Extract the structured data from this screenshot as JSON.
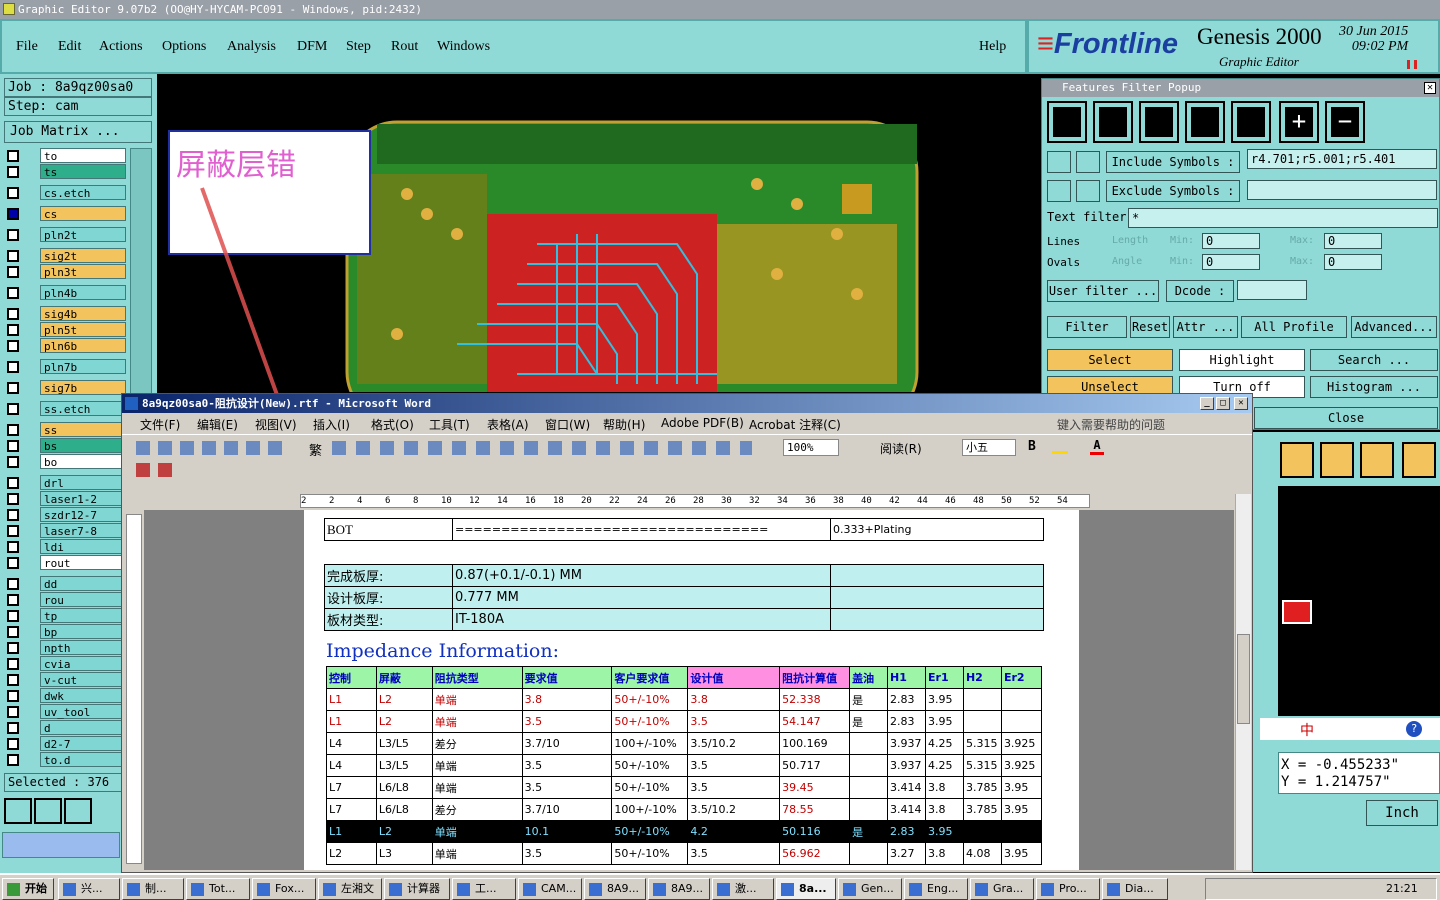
{
  "app": {
    "title": "Graphic Editor 9.07b2  (OO@HY-HYCAM-PC091 - Windows, pid:2432)",
    "menu": [
      "File",
      "Edit",
      "Actions",
      "Options",
      "Analysis",
      "DFM",
      "Step",
      "Rout",
      "Windows"
    ],
    "help": "Help",
    "brand": "Frontline",
    "product": "Genesis 2000",
    "subtitle": "Graphic Editor",
    "date": "30 Jun 2015",
    "time": "09:02 PM"
  },
  "left": {
    "job": "Job : 8a9qz00sa0",
    "step": "Step: cam",
    "job_matrix": "Job Matrix ...",
    "selected": "Selected : 376",
    "layers": [
      {
        "name": "to",
        "color": "#ffffff"
      },
      {
        "name": "ts",
        "color": "#2fae8c"
      },
      {
        "name": "cs.etch",
        "color": "#7fd6d2"
      },
      {
        "name": "cs",
        "color": "#f3c35e",
        "active": true
      },
      {
        "name": "pln2t",
        "color": "#7fd6d2"
      },
      {
        "name": "sig2t",
        "color": "#f3c35e"
      },
      {
        "name": "pln3t",
        "color": "#f3c35e"
      },
      {
        "name": "pln4b",
        "color": "#7fd6d2"
      },
      {
        "name": "sig4b",
        "color": "#f3c35e"
      },
      {
        "name": "pln5t",
        "color": "#f3c35e"
      },
      {
        "name": "pln6b",
        "color": "#f3c35e"
      },
      {
        "name": "pln7b",
        "color": "#7fd6d2"
      },
      {
        "name": "sig7b",
        "color": "#f3c35e"
      },
      {
        "name": "ss.etch",
        "color": "#7fd6d2"
      },
      {
        "name": "ss",
        "color": "#f3c35e"
      },
      {
        "name": "bs",
        "color": "#2fae8c"
      },
      {
        "name": "bo",
        "color": "#ffffff"
      },
      {
        "name": "drl",
        "color": "#7fd6d2"
      },
      {
        "name": "laser1-2",
        "color": "#7fd6d2"
      },
      {
        "name": "szdr12-7",
        "color": "#7fd6d2"
      },
      {
        "name": "laser7-8",
        "color": "#7fd6d2"
      },
      {
        "name": "ldi",
        "color": "#7fd6d2"
      },
      {
        "name": "rout",
        "color": "#ffffff"
      },
      {
        "name": "dd",
        "color": "#7fd6d2"
      },
      {
        "name": "rou",
        "color": "#7fd6d2"
      },
      {
        "name": "tp",
        "color": "#7fd6d2"
      },
      {
        "name": "bp",
        "color": "#7fd6d2"
      },
      {
        "name": "npth",
        "color": "#7fd6d2"
      },
      {
        "name": "cvia",
        "color": "#7fd6d2"
      },
      {
        "name": "v-cut",
        "color": "#7fd6d2"
      },
      {
        "name": "dwk",
        "color": "#7fd6d2"
      },
      {
        "name": "uv_tool",
        "color": "#7fd6d2"
      },
      {
        "name": "d",
        "color": "#7fd6d2"
      },
      {
        "name": "d2-7",
        "color": "#7fd6d2"
      },
      {
        "name": "to.d",
        "color": "#7fd6d2"
      }
    ]
  },
  "annotation": "屏蔽层错",
  "filter": {
    "title": "Features Filter Popup",
    "include_label": "Include Symbols :",
    "include_value": "r4.701;r5.001;r5.401",
    "exclude_label": "Exclude Symbols :",
    "exclude_value": "",
    "text_filter_label": "Text filter",
    "text_filter_value": "*",
    "lines": "Lines",
    "ovals": "Ovals",
    "length": "Length",
    "angle": "Angle",
    "min": "Min:",
    "max": "Max:",
    "zero": "0",
    "user_filter": "User filter ...",
    "dcode": "Dcode :",
    "filter": "Filter",
    "reset": "Reset",
    "attr": "Attr ...",
    "all_profile": "All Profile",
    "advanced": "Advanced...",
    "select": "Select",
    "highlight": "Highlight",
    "search": "Search ...",
    "unselect": "Unselect",
    "turn_off": "Turn off",
    "histogram": "Histogram ...",
    "close": "Close"
  },
  "coords": {
    "x": "X = -0.455233\"",
    "y": "Y = 1.214757\"",
    "unit": "Inch"
  },
  "ime": "中",
  "word": {
    "title": "8a9qz00sa0-阻抗设计(New).rtf - Microsoft Word",
    "menu": [
      "文件(F)",
      "编辑(E)",
      "视图(V)",
      "插入(I)",
      "格式(O)",
      "工具(T)",
      "表格(A)",
      "窗口(W)",
      "帮助(H)",
      "Adobe PDF(B)",
      "Acrobat 注释(C)"
    ],
    "help_prompt": "键入需要帮助的问题",
    "zoom": "100%",
    "read": "阅读(R)",
    "font_size": "小五",
    "bold": "B",
    "fan": "繁",
    "ruler": [
      "2",
      "2",
      "4",
      "6",
      "8",
      "10",
      "12",
      "14",
      "16",
      "18",
      "20",
      "22",
      "24",
      "26",
      "28",
      "30",
      "32",
      "34",
      "36",
      "38",
      "40",
      "42",
      "44",
      "46",
      "48",
      "50",
      "52",
      "54"
    ],
    "bot_row": {
      "name": "BOT",
      "fill": "==================================",
      "val": "0.333+Plating"
    },
    "specs": [
      {
        "k": "完成板厚:",
        "v": "0.87(+0.1/-0.1) MM"
      },
      {
        "k": "设计板厚:",
        "v": "0.777 MM"
      },
      {
        "k": "板材类型:",
        "v": "IT-180A"
      }
    ],
    "impedance_title": "Impedance Information:",
    "headers": [
      "控制",
      "屏蔽",
      "阻抗类型",
      "要求值",
      "客户要求值",
      "设计值",
      "阻抗计算值",
      "盖油",
      "H1",
      "Er1",
      "H2",
      "Er2"
    ],
    "rows": [
      {
        "style": "red",
        "c": [
          "L1",
          "L2",
          "单端",
          "3.8",
          "50+/-10%",
          "3.8",
          "52.338",
          "是",
          "2.83",
          "3.95",
          "",
          ""
        ]
      },
      {
        "style": "red",
        "c": [
          "L1",
          "L2",
          "单端",
          "3.5",
          "50+/-10%",
          "3.5",
          "54.147",
          "是",
          "2.83",
          "3.95",
          "",
          ""
        ]
      },
      {
        "style": "normal",
        "c": [
          "L4",
          "L3/L5",
          "差分",
          "3.7/10",
          "100+/-10%",
          "3.5/10.2",
          "100.169",
          "",
          "3.937",
          "4.25",
          "5.315",
          "3.925"
        ]
      },
      {
        "style": "normal",
        "c": [
          "L4",
          "L3/L5",
          "单端",
          "3.5",
          "50+/-10%",
          "3.5",
          "50.717",
          "",
          "3.937",
          "4.25",
          "5.315",
          "3.925"
        ]
      },
      {
        "style": "mixed",
        "c": [
          "L7",
          "L6/L8",
          "单端",
          "3.5",
          "50+/-10%",
          "3.5",
          "39.45",
          "",
          "3.414",
          "3.8",
          "3.785",
          "3.95"
        ]
      },
      {
        "style": "mixed",
        "c": [
          "L7",
          "L6/L8",
          "差分",
          "3.7/10",
          "100+/-10%",
          "3.5/10.2",
          "78.55",
          "",
          "3.414",
          "3.8",
          "3.785",
          "3.95"
        ]
      },
      {
        "style": "black",
        "c": [
          "L1",
          "L2",
          "单端",
          "10.1",
          "50+/-10%",
          "4.2",
          "50.116",
          "是",
          "2.83",
          "3.95",
          "",
          ""
        ]
      },
      {
        "style": "mixed",
        "c": [
          "L2",
          "L3",
          "单端",
          "3.5",
          "50+/-10%",
          "3.5",
          "56.962",
          "",
          "3.27",
          "3.8",
          "4.08",
          "3.95"
        ]
      }
    ]
  },
  "taskbar": {
    "start": "开始",
    "tasks": [
      "兴...",
      "制...",
      "Tot...",
      "Fox...",
      "左湘文",
      "计算器",
      "工...",
      "CAM...",
      "8A9...",
      "8A9...",
      "激...",
      "8a...",
      "Gen...",
      "Eng...",
      "Gra...",
      "Pro...",
      "Dia..."
    ],
    "clock": "21:21"
  }
}
